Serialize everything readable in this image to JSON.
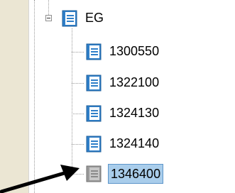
{
  "tree": {
    "root": {
      "label": "EG",
      "expanded": true,
      "icon": "document-blue-icon"
    },
    "children": [
      {
        "label": "1300550",
        "icon": "document-blue-icon",
        "selected": false
      },
      {
        "label": "1322100",
        "icon": "document-blue-icon",
        "selected": false
      },
      {
        "label": "1324130",
        "icon": "document-blue-icon",
        "selected": false
      },
      {
        "label": "1324140",
        "icon": "document-blue-icon",
        "selected": false
      },
      {
        "label": "1346400",
        "icon": "document-gray-icon",
        "selected": true
      }
    ]
  },
  "annotation": {
    "icon": "pointer-arrow-icon"
  },
  "colors": {
    "background": "#ebe6d3",
    "selection": "#a9cdeb",
    "selection_border": "#5d95c9",
    "icon_blue": "#2f7fc9",
    "icon_gray": "#9a9a9a"
  }
}
